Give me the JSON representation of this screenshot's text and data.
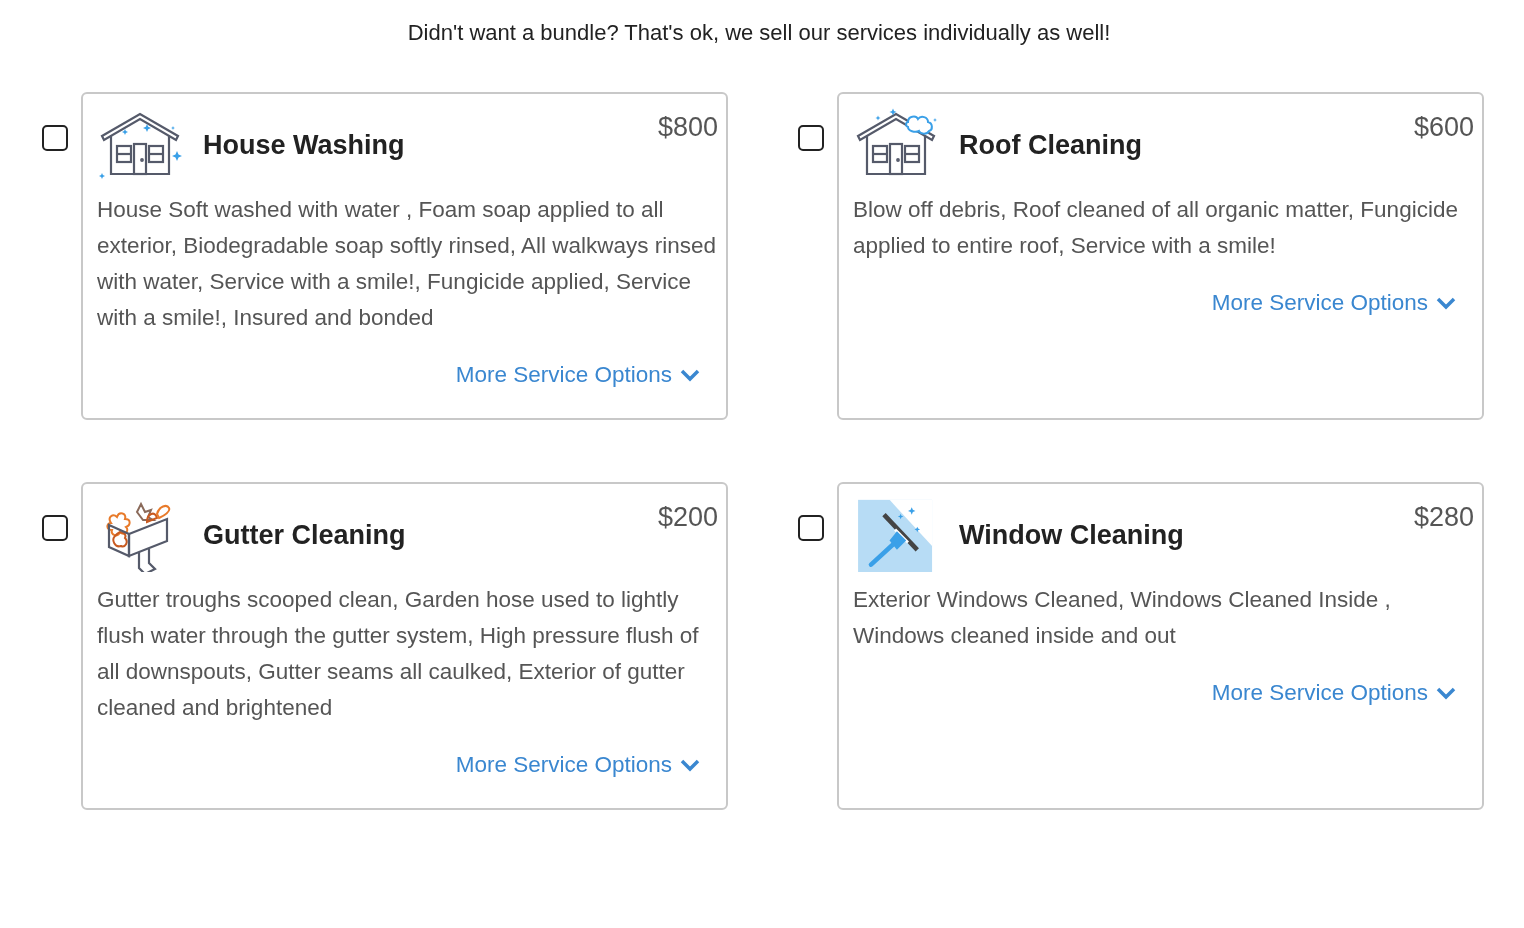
{
  "heading": "Didn't want a bundle? That's ok, we sell our services individually as well!",
  "services": [
    {
      "kind": "house",
      "checked": false,
      "title": "House Washing",
      "price": "$800",
      "description": "House Soft washed with water , Foam soap applied to all exterior, Biodegradable soap softly rinsed, All walkways rinsed with water, Service with a smile!, Fungicide applied, Service with a smile!, Insured and bonded",
      "link": "More Service Options"
    },
    {
      "kind": "roof",
      "checked": false,
      "title": "Roof Cleaning",
      "price": "$600",
      "description": "Blow off debris, Roof cleaned of all organic matter, Fungicide applied to entire roof, Service with a smile!",
      "link": "More Service Options"
    },
    {
      "kind": "gutter",
      "checked": false,
      "title": "Gutter Cleaning",
      "price": "$200",
      "description": "Gutter troughs scooped clean, Garden hose used to lightly flush water through the gutter system, High pressure flush of all downspouts, Gutter seams all caulked, Exterior of gutter cleaned and brightened",
      "link": "More Service Options"
    },
    {
      "kind": "window",
      "checked": false,
      "title": "Window Cleaning",
      "price": "$280",
      "description": "Exterior Windows Cleaned, Windows Cleaned Inside , Windows cleaned inside and out",
      "link": "More Service Options"
    }
  ]
}
